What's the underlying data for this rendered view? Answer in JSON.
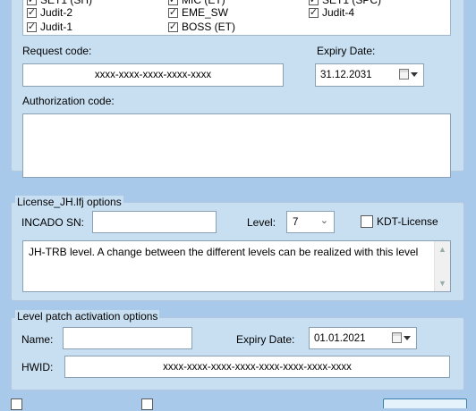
{
  "modules": {
    "rows_partial": [
      "SET1 (SH)",
      "MIC (ET)",
      "SET1 (SPC)"
    ],
    "items": [
      {
        "label": "Judit-2",
        "checked": true
      },
      {
        "label": "EME_SW",
        "checked": true
      },
      {
        "label": "Judit-4",
        "checked": true
      },
      {
        "label": "Judit-1",
        "checked": true
      },
      {
        "label": "BOSS (ET)",
        "checked": true
      }
    ]
  },
  "request": {
    "label": "Request code:",
    "value": "xxxx-xxxx-xxxx-xxxx-xxxx",
    "expiry_label": "Expiry Date:",
    "expiry_value": "31.12.2031"
  },
  "authorization": {
    "label": "Authorization code:",
    "value": ""
  },
  "license_options": {
    "title": "License_JH.lfj options",
    "incado_label": "INCADO SN:",
    "incado_value": "",
    "level_label": "Level:",
    "level_value": "7",
    "kdt_label": "KDT-License",
    "kdt_checked": false,
    "description": "JH-TRB level. A change between the different levels can be realized with this level"
  },
  "level_patch": {
    "title": "Level patch activation options",
    "name_label": "Name:",
    "name_value": "",
    "expiry_label": "Expiry Date:",
    "expiry_value": "01.01.2021",
    "hwid_label": "HWID:",
    "hwid_value": "xxxx-xxxx-xxxx-xxxx-xxxx-xxxx-xxxx-xxxx"
  },
  "bottom": {
    "opt1_label": "",
    "opt2_label": ""
  }
}
